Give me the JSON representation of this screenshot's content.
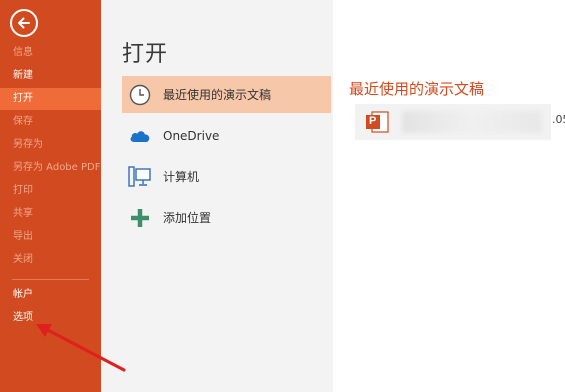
{
  "sidebar": {
    "items": [
      {
        "label": "信息"
      },
      {
        "label": "新建"
      },
      {
        "label": "打开"
      },
      {
        "label": "保存"
      },
      {
        "label": "另存为"
      },
      {
        "label": "另存为 Adobe PDF"
      },
      {
        "label": "打印"
      },
      {
        "label": "共享"
      },
      {
        "label": "导出"
      },
      {
        "label": "关闭"
      },
      {
        "label": "帐户"
      },
      {
        "label": "选项"
      }
    ]
  },
  "page": {
    "title": "打开"
  },
  "locations": [
    {
      "label": "最近使用的演示文稿",
      "icon": "clock-icon"
    },
    {
      "label": "OneDrive",
      "icon": "cloud-icon"
    },
    {
      "label": "计算机",
      "icon": "computer-icon"
    },
    {
      "label": "添加位置",
      "icon": "plus-icon"
    }
  ],
  "recent": {
    "title": "最近使用的演示文稿",
    "file_name_tail": ".05",
    "file_icon_letter": "P"
  },
  "colors": {
    "brand": "#d24a1f",
    "active_item": "#ef6c3a",
    "selected_location": "#f7c7aa",
    "annotation_arrow": "#e0201c"
  }
}
